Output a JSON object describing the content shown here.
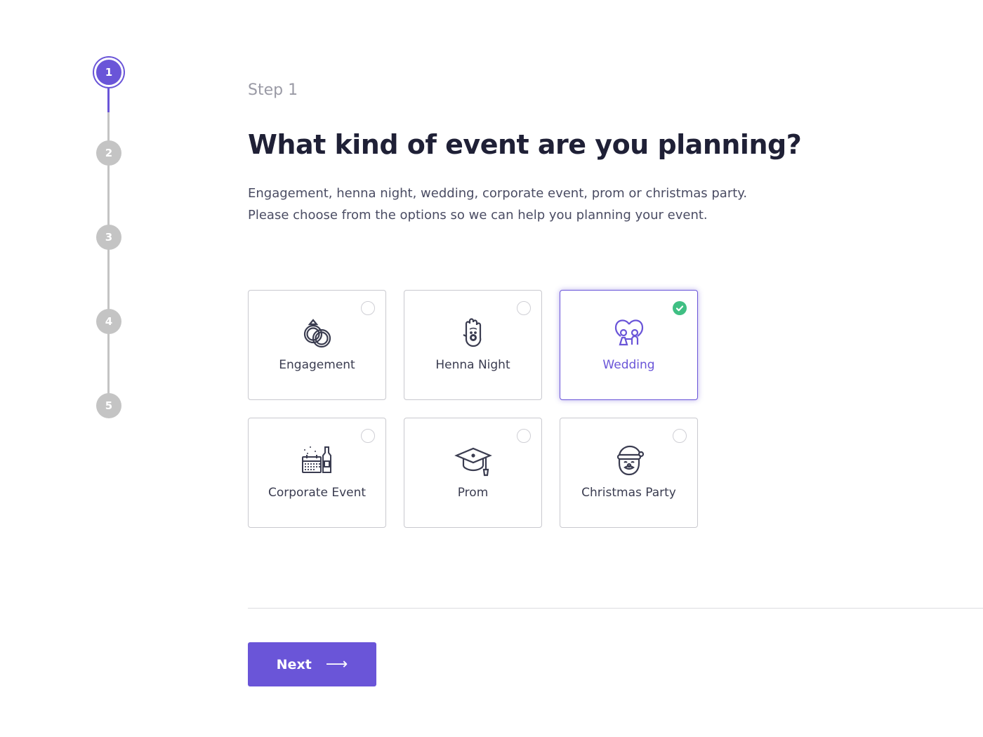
{
  "colors": {
    "accent": "#6a55d8",
    "inactive": "#c4c4c4",
    "success": "#3fbf83",
    "title": "#1f2036",
    "text": "#4a4c63"
  },
  "stepper": {
    "current_step": 1,
    "steps": [
      "1",
      "2",
      "3",
      "4",
      "5"
    ]
  },
  "header": {
    "step_label": "Step 1",
    "title": "What kind of event are you planning?",
    "description_line1": "Engagement, henna night, wedding, corporate event, prom or christmas party.",
    "description_line2": "Please choose from the options so we can help you planning your event."
  },
  "options": [
    {
      "label": "Engagement",
      "icon": "rings-icon",
      "selected": false
    },
    {
      "label": "Henna Night",
      "icon": "henna-hand-icon",
      "selected": false
    },
    {
      "label": "Wedding",
      "icon": "wedding-couple-icon",
      "selected": true
    },
    {
      "label": "Corporate Event",
      "icon": "calendar-bottle-icon",
      "selected": false
    },
    {
      "label": "Prom",
      "icon": "graduation-cap-icon",
      "selected": false
    },
    {
      "label": "Christmas Party",
      "icon": "santa-icon",
      "selected": false
    }
  ],
  "footer": {
    "next_label": "Next",
    "next_icon": "arrow-right-icon"
  }
}
